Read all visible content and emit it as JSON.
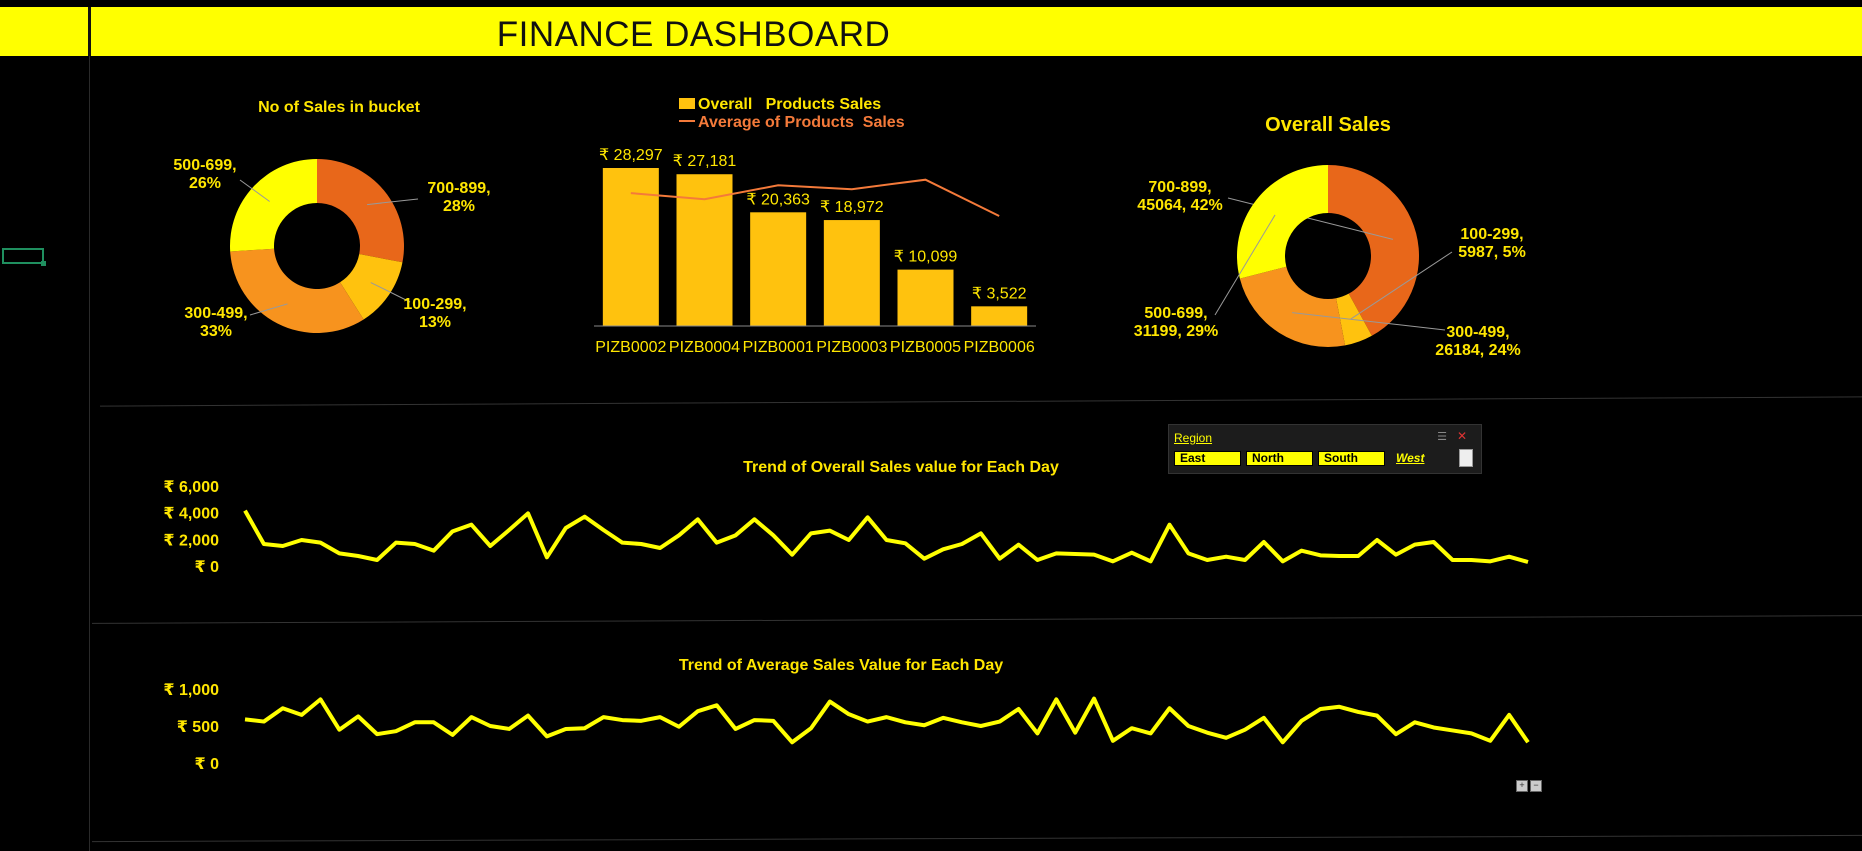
{
  "header": {
    "title": "FINANCE DASHBOARD"
  },
  "colors": {
    "banner": "#ffff00",
    "label": "#ffe600",
    "dark_orange": "#e8671a",
    "orange": "#f7931e",
    "gold": "#ffc20e",
    "yellow": "#ffff00",
    "line": "#ffff00",
    "avg_line": "#f47a3a"
  },
  "slicer": {
    "title": "Region",
    "items": [
      "East",
      "North",
      "South",
      "West"
    ],
    "selected": [
      "East",
      "North",
      "South"
    ]
  },
  "chart_data": [
    {
      "id": "bucket",
      "type": "pie",
      "title": "No of Sales in bucket",
      "slices": [
        {
          "name": "700-899",
          "pct": 28,
          "label": "700-899,\n28%",
          "color": "#e8671a"
        },
        {
          "name": "100-299",
          "pct": 13,
          "label": "100-299,\n13%",
          "color": "#ffc20e"
        },
        {
          "name": "300-499",
          "pct": 33,
          "label": "300-499,\n33%",
          "color": "#f7931e"
        },
        {
          "name": "500-699",
          "pct": 26,
          "label": "500-699,\n26%",
          "color": "#ffff00"
        }
      ]
    },
    {
      "id": "products",
      "type": "bar",
      "title": "",
      "categories": [
        "PIZB0002",
        "PIZB0004",
        "PIZB0001",
        "PIZB0003",
        "PIZB0005",
        "PIZB0006"
      ],
      "series": [
        {
          "name": "Overall   Products Sales",
          "type": "bar",
          "values": [
            28297,
            27181,
            20363,
            18972,
            10099,
            3522
          ],
          "labels": [
            "₹ 28,297",
            "₹ 27,181",
            "₹ 20,363",
            "₹ 18,972",
            "₹ 10,099",
            "₹ 3,522"
          ]
        },
        {
          "name": "Average of Products  Sales",
          "type": "line",
          "values": [
            23800,
            22700,
            25200,
            24500,
            26200,
            19700
          ]
        }
      ],
      "ylim": [
        0,
        30000
      ]
    },
    {
      "id": "overall",
      "type": "pie",
      "title": "Overall Sales",
      "slices": [
        {
          "name": "700-899",
          "value": 45064,
          "pct": 42,
          "label": "700-899,\n45064, 42%",
          "color": "#e8671a"
        },
        {
          "name": "100-299",
          "value": 5987,
          "pct": 5,
          "label": "100-299,\n5987, 5%",
          "color": "#ffc20e"
        },
        {
          "name": "300-499",
          "value": 26184,
          "pct": 24,
          "label": "300-499,\n26184, 24%",
          "color": "#f7931e"
        },
        {
          "name": "500-699",
          "value": 31199,
          "pct": 29,
          "label": "500-699,\n31199, 29%",
          "color": "#ffff00"
        }
      ]
    },
    {
      "id": "trend_total",
      "type": "line",
      "title": "Trend of Overall Sales value for Each Day",
      "ylim": [
        0,
        6000
      ],
      "yticks": [
        "₹ 6,000",
        "₹ 4,000",
        "₹ 2,000",
        "₹ 0"
      ],
      "values": [
        4150,
        1650,
        1500,
        1950,
        1750,
        950,
        750,
        450,
        1750,
        1650,
        1150,
        2600,
        3100,
        1500,
        2700,
        3950,
        650,
        2850,
        3700,
        2700,
        1750,
        1650,
        1350,
        2300,
        3500,
        1750,
        2300,
        3500,
        2300,
        850,
        2450,
        2650,
        1950,
        3650,
        1950,
        1700,
        550,
        1250,
        1650,
        2450,
        550,
        1600,
        450,
        950,
        900,
        850,
        350,
        1000,
        350,
        3100,
        950,
        450,
        700,
        450,
        1800,
        350,
        1150,
        800,
        750,
        750,
        1950,
        850,
        1600,
        1800,
        450,
        450,
        350,
        700,
        300
      ]
    },
    {
      "id": "trend_avg",
      "type": "line",
      "title": "Trend of Average Sales Value for Each Day",
      "ylim": [
        0,
        1000
      ],
      "yticks": [
        "₹ 1,000",
        "₹ 500",
        "₹ 0"
      ],
      "values": [
        590,
        560,
        740,
        650,
        860,
        450,
        630,
        390,
        430,
        550,
        550,
        380,
        620,
        500,
        460,
        640,
        360,
        460,
        470,
        620,
        580,
        570,
        620,
        490,
        700,
        780,
        460,
        580,
        570,
        280,
        470,
        830,
        660,
        560,
        620,
        550,
        510,
        610,
        550,
        500,
        560,
        730,
        400,
        860,
        410,
        870,
        300,
        470,
        400,
        740,
        500,
        410,
        340,
        450,
        610,
        280,
        570,
        730,
        760,
        690,
        640,
        390,
        550,
        480,
        440,
        400,
        300,
        650,
        280
      ]
    }
  ]
}
